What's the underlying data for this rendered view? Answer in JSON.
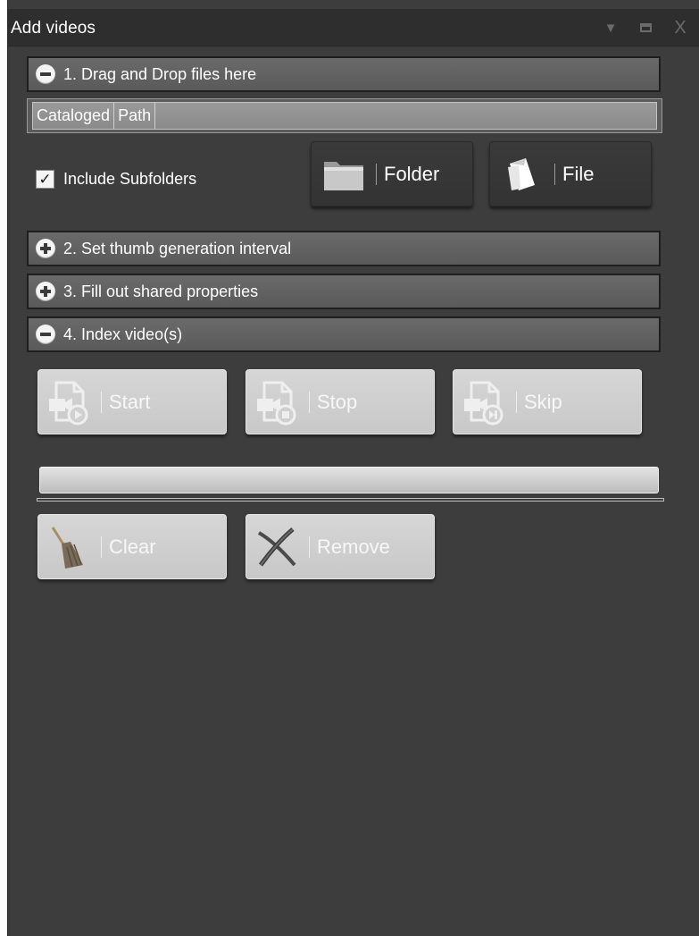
{
  "window": {
    "title": "Add videos",
    "controls": [
      "dropdown-icon",
      "maximize-icon",
      "close-icon"
    ],
    "close_glyph": "X"
  },
  "sections": [
    {
      "label": "1. Drag and Drop files here",
      "expanded": true
    },
    {
      "label": "2. Set thumb generation interval",
      "expanded": false
    },
    {
      "label": "3. Fill out shared properties",
      "expanded": false
    },
    {
      "label": "4. Index video(s)",
      "expanded": true
    }
  ],
  "file_list": {
    "columns": [
      "Cataloged",
      "Path"
    ]
  },
  "include_subfolders": {
    "label": "Include Subfolders",
    "checked": true
  },
  "add_buttons": {
    "folder": "Folder",
    "file": "File"
  },
  "index_buttons": {
    "start": "Start",
    "stop": "Stop",
    "skip": "Skip"
  },
  "progress": {
    "value": 0
  },
  "bottom_buttons": {
    "clear": "Clear",
    "remove": "Remove"
  },
  "colors": {
    "panel": "#3d3d3d",
    "titlebar": "#2e2e2e",
    "section_header": "#616161",
    "disabled_button": "#cfcfcf"
  }
}
